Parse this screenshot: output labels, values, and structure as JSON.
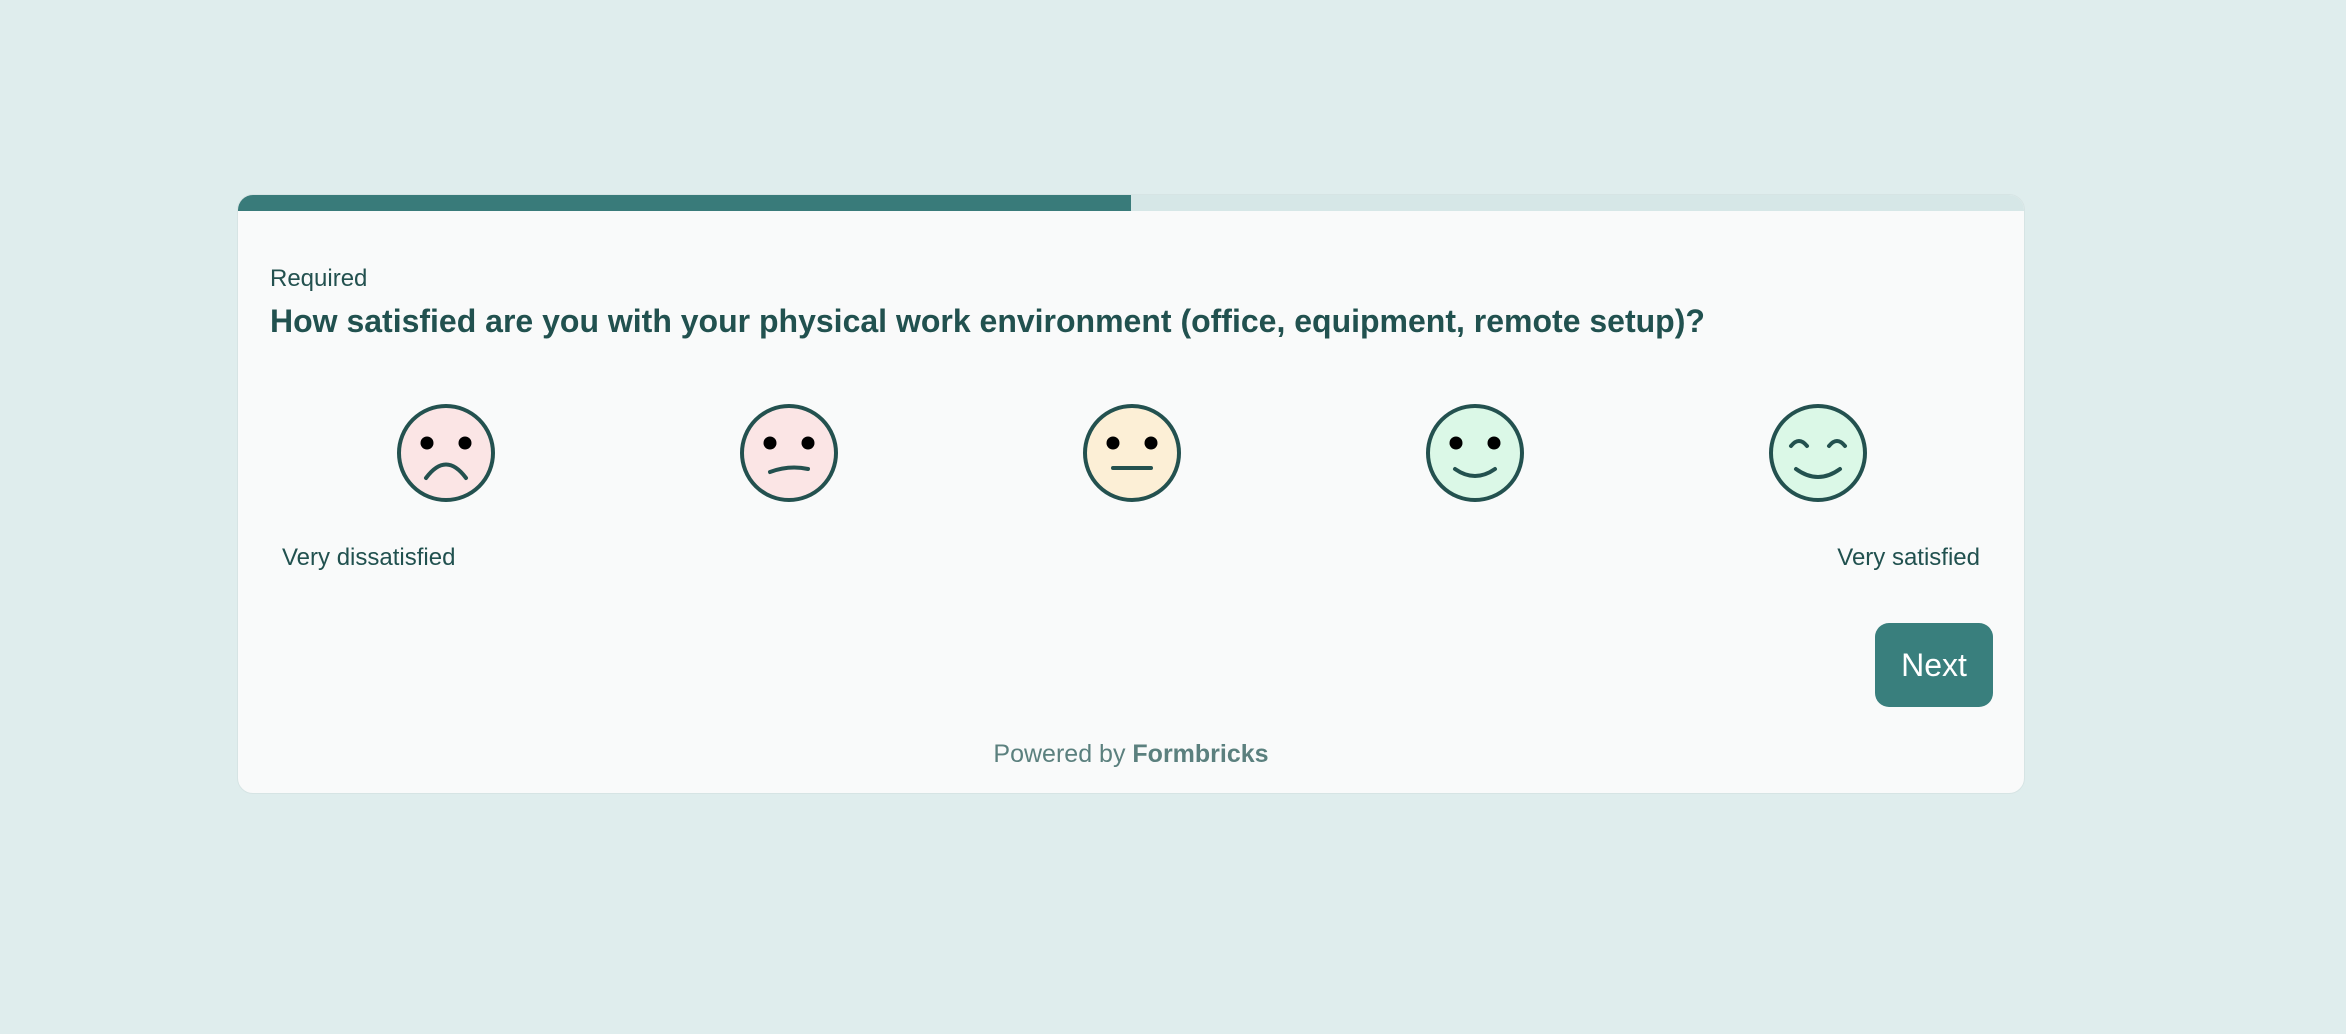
{
  "progress": {
    "value": 0.5,
    "fill_color": "#397b7a",
    "track_color": "#d6e7e7"
  },
  "question": {
    "required_text": "Required",
    "title": "How satisfied are you with your physical work environment (office, equipment, remote setup)?"
  },
  "rating": {
    "options": [
      {
        "icon": "very-dissatisfied-face-icon",
        "fill": "#fbe5e5"
      },
      {
        "icon": "dissatisfied-face-icon",
        "fill": "#fbe5e5"
      },
      {
        "icon": "neutral-face-icon",
        "fill": "#fcefd6"
      },
      {
        "icon": "satisfied-face-icon",
        "fill": "#dbf8e7"
      },
      {
        "icon": "very-satisfied-face-icon",
        "fill": "#dbf8e7"
      }
    ],
    "lower_label": "Very dissatisfied",
    "upper_label": "Very satisfied"
  },
  "buttons": {
    "next_label": "Next"
  },
  "footer": {
    "powered_prefix": "Powered by",
    "brand": "Formbricks"
  },
  "colors": {
    "accent": "#397f7d",
    "text": "#21514f",
    "background": "#dfeded",
    "card": "#f9fafa"
  }
}
